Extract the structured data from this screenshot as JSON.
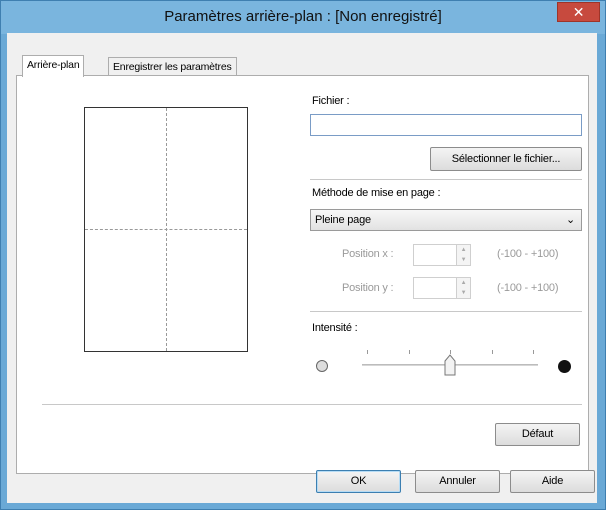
{
  "window": {
    "title": "Paramètres arrière-plan : [Non enregistré]",
    "close_glyph": "✕"
  },
  "tabs": [
    {
      "label": "Arrière-plan",
      "active": true
    },
    {
      "label": "Enregistrer les paramètres",
      "active": false
    }
  ],
  "file": {
    "label": "Fichier :",
    "value": "",
    "select_button": "Sélectionner le fichier..."
  },
  "layout": {
    "label": "Méthode de mise en page :",
    "selected": "Pleine page",
    "position_x": {
      "label": "Position x :",
      "value": "",
      "range": "(-100 - +100)"
    },
    "position_y": {
      "label": "Position y :",
      "value": "",
      "range": "(-100 - +100)"
    }
  },
  "intensity": {
    "label": "Intensité :",
    "tick_count": 5,
    "value_fraction": 0.5
  },
  "buttons": {
    "default": "Défaut",
    "ok": "OK",
    "cancel": "Annuler",
    "help": "Aide"
  },
  "colors": {
    "titlebar": "#7ab5de",
    "close": "#c74a3e"
  }
}
